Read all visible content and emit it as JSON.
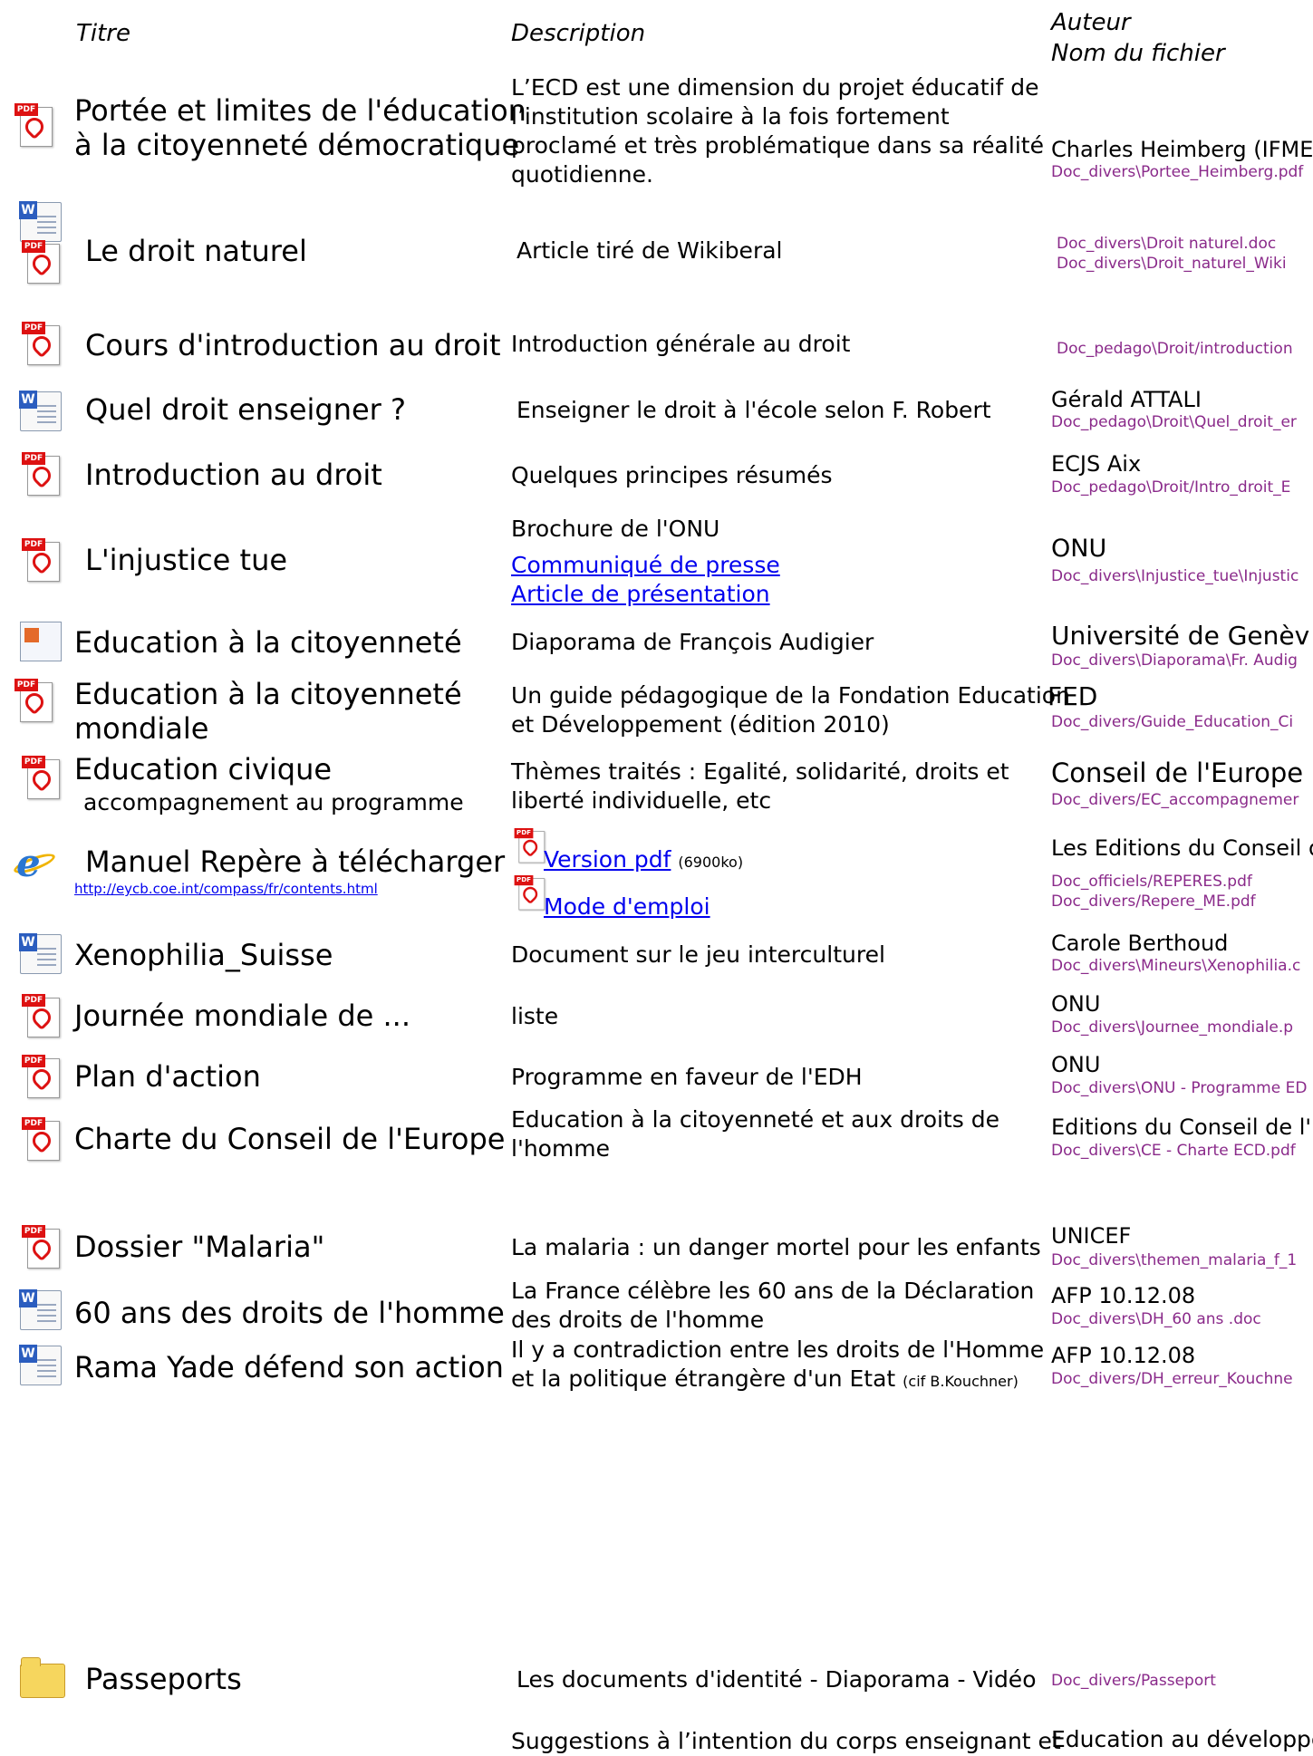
{
  "headers": {
    "titre": "Titre",
    "description": "Description",
    "auteur": "Auteur",
    "fichier": "Nom du fichier"
  },
  "rows": [
    {
      "title": [
        "Portée et limites de l'éducation",
        "à la citoyenneté démocratique"
      ],
      "description": [
        "L’ECD est une dimension du projet éducatif de",
        "l’institution scolaire à la fois fortement",
        "proclamé et très problématique dans sa réalité",
        "quotidienne."
      ],
      "author": "Charles Heimberg (IFMES",
      "file": "Doc_divers\\Portee_Heimberg.pdf"
    },
    {
      "title": [
        "Le droit naturel"
      ],
      "description": [
        "Article tiré de Wikiberal"
      ],
      "files": [
        "Doc_divers\\Droit naturel.doc",
        "Doc_divers\\Droit_naturel_Wiki"
      ]
    },
    {
      "title": [
        "Cours d'introduction au droit"
      ],
      "description": [
        "Introduction générale au droit"
      ],
      "file": "Doc_pedago\\Droit/introduction"
    },
    {
      "title": [
        "Quel droit enseigner ?"
      ],
      "description": [
        "Enseigner le droit à l'école selon F. Robert"
      ],
      "author": "Gérald ATTALI",
      "file": "Doc_pedago\\Droit\\Quel_droit_er"
    },
    {
      "title": [
        "Introduction au droit"
      ],
      "description": [
        "Quelques principes résumés"
      ],
      "author": "ECJS Aix",
      "file": "Doc_pedago\\Droit/Intro_droit_E"
    },
    {
      "title": [
        "L'injustice tue"
      ],
      "description": [
        "Brochure de l'ONU"
      ],
      "links": [
        "Communiqué de presse",
        "Article de présentation"
      ],
      "author": "ONU",
      "file": "Doc_divers\\Injustice_tue\\Injustic"
    },
    {
      "title": [
        "Education à la citoyenneté"
      ],
      "description": [
        "Diaporama de François Audigier"
      ],
      "author": "Université de Genèv",
      "file": "Doc_divers\\Diaporama\\Fr. Audig"
    },
    {
      "title": [
        "Education à la citoyenneté",
        "mondiale"
      ],
      "description": [
        "Un guide pédagogique de la Fondation Education",
        "et Développement (édition 2010)"
      ],
      "author": "FED",
      "file": "Doc_divers/Guide_Education_Ci"
    },
    {
      "title": [
        "Education civique"
      ],
      "subtitle": "accompagnement au programme",
      "description": [
        "Thèmes traités : Egalité, solidarité, droits et",
        "liberté individuelle, etc"
      ],
      "author": "Conseil de l'Europe",
      "file": "Doc_divers/EC_accompagnemer"
    },
    {
      "title": [
        "Manuel Repère à télécharger"
      ],
      "url": "http://eycb.coe.int/compass/fr/contents.html",
      "link1": "Version pdf",
      "link1_size": "(6900ko)",
      "link2": "Mode d'emploi",
      "author": "Les Editions du Conseil d",
      "files": [
        "Doc_officiels/REPERES.pdf",
        "Doc_divers/Repere_ME.pdf"
      ]
    },
    {
      "title": [
        "Xenophilia_Suisse"
      ],
      "description": [
        "Document sur le jeu interculturel"
      ],
      "author": "Carole Berthoud",
      "file": "Doc_divers\\Mineurs\\Xenophilia.c"
    },
    {
      "title": [
        "Journée mondiale de ..."
      ],
      "description": [
        "liste"
      ],
      "author": "ONU",
      "file": "Doc_divers\\Journee_mondiale.p"
    },
    {
      "title": [
        "Plan d'action"
      ],
      "description": [
        "Programme en faveur de l'EDH"
      ],
      "author": "ONU",
      "file": "Doc_divers\\ONU - Programme ED"
    },
    {
      "title": [
        "Charte du Conseil de l'Europe"
      ],
      "description": [
        "Education à la citoyenneté et aux droits de",
        "l'homme"
      ],
      "author": "Editions du Conseil de l'",
      "file": "Doc_divers\\CE - Charte ECD.pdf"
    },
    {
      "title": [
        "Dossier \"Malaria\""
      ],
      "description": [
        "La malaria : un danger mortel pour les enfants"
      ],
      "author": "UNICEF",
      "file": "Doc_divers\\themen_malaria_f_1"
    },
    {
      "title": [
        "60 ans des droits de l'homme"
      ],
      "description": [
        "La France célèbre les 60 ans de la Déclaration",
        "des droits de l'homme"
      ],
      "author": "AFP 10.12.08",
      "file": "Doc_divers\\DH_60 ans .doc"
    },
    {
      "title": [
        "Rama Yade défend son action"
      ],
      "description": [
        "Il y a contradiction  entre les droits de l'Homme",
        "et la politique étrangère d'un Etat"
      ],
      "desc_small": "(cif B.Kouchner)",
      "author": "AFP 10.12.08",
      "file": "Doc_divers/DH_erreur_Kouchne"
    },
    {
      "title": [
        "Passeports"
      ],
      "description": [
        "Les documents d'identité - Diaporama - Vidéo"
      ],
      "file": "Doc_divers/Passeport"
    },
    {
      "description": [
        "Suggestions à l’intention du corps enseignant et"
      ],
      "author": "Education au développe"
    }
  ]
}
